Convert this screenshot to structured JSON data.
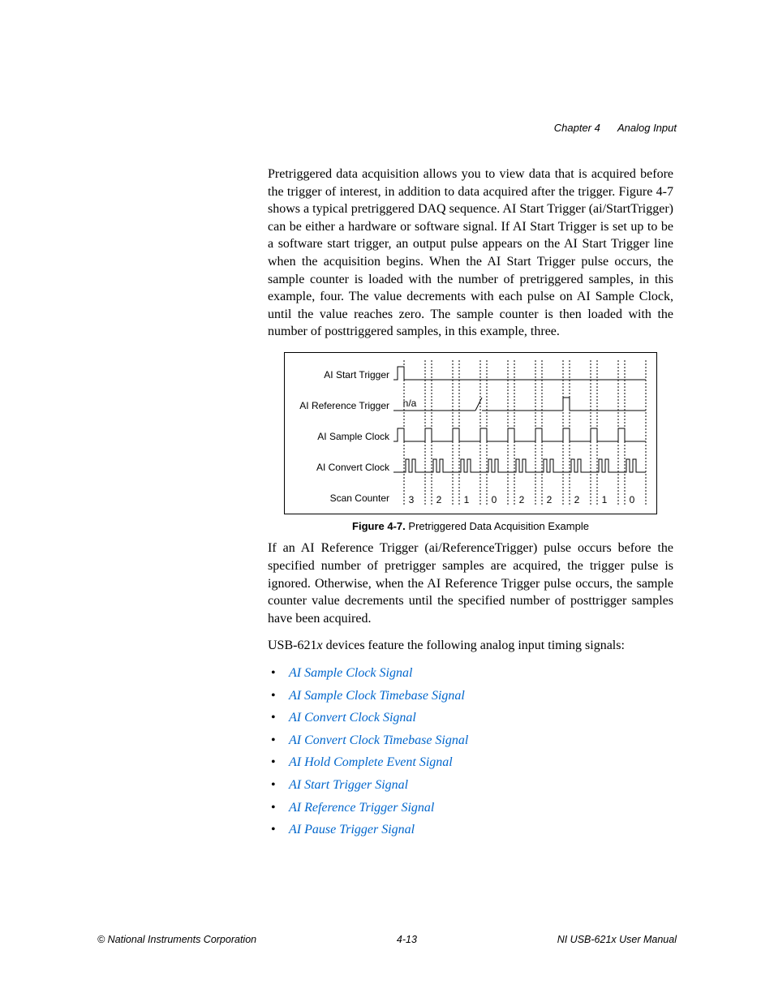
{
  "header": {
    "chapter": "Chapter 4",
    "title": "Analog Input"
  },
  "paragraph1": "Pretriggered data acquisition allows you to view data that is acquired before the trigger of interest, in addition to data acquired after the trigger. Figure 4-7 shows a typical pretriggered DAQ sequence. AI Start Trigger (ai/StartTrigger) can be either a hardware or software signal. If AI Start Trigger is set up to be a software start trigger, an output pulse appears on the AI Start Trigger line when the acquisition begins. When the AI Start Trigger pulse occurs, the sample counter is loaded with the number of pretriggered samples, in this example, four. The value decrements with each pulse on AI Sample Clock, until the value reaches zero. The sample counter is then loaded with the number of posttriggered samples, in this example, three.",
  "figure": {
    "labels": {
      "start": "AI Start Trigger",
      "reference": "AI Reference Trigger",
      "sample": "AI Sample Clock",
      "convert": "AI Convert Clock",
      "scan": "Scan Counter",
      "na": "n/a"
    },
    "caption_bold": "Figure 4-7.",
    "caption_rest": "  Pretriggered Data Acquisition Example"
  },
  "chart_data": {
    "type": "table",
    "title": "Figure 4-7. Pretriggered Data Acquisition Example",
    "signals": [
      "AI Start Trigger",
      "AI Reference Trigger",
      "AI Sample Clock",
      "AI Convert Clock",
      "Scan Counter"
    ],
    "scan_counter_values": [
      3,
      2,
      1,
      0,
      2,
      2,
      2,
      1,
      0
    ],
    "reference_trigger_note": "n/a",
    "reference_trigger_pulse_index": 6,
    "start_trigger_pulse_index": 0
  },
  "paragraph2": "If an AI Reference Trigger (ai/ReferenceTrigger) pulse occurs before the specified number of pretrigger samples are acquired, the trigger pulse is ignored. Otherwise, when the AI Reference Trigger pulse occurs, the sample counter value decrements until the specified number of posttrigger samples have been acquired.",
  "paragraph3_prefix": "USB-621",
  "paragraph3_x": "x",
  "paragraph3_rest": " devices feature the following analog input timing signals:",
  "links": [
    "AI Sample Clock Signal",
    "AI Sample Clock Timebase Signal",
    "AI Convert Clock Signal",
    "AI Convert Clock Timebase Signal",
    "AI Hold Complete Event Signal",
    "AI Start Trigger Signal",
    "AI Reference Trigger Signal",
    "AI Pause Trigger Signal"
  ],
  "footer": {
    "left": "© National Instruments Corporation",
    "center": "4-13",
    "right": "NI USB-621x User Manual"
  }
}
